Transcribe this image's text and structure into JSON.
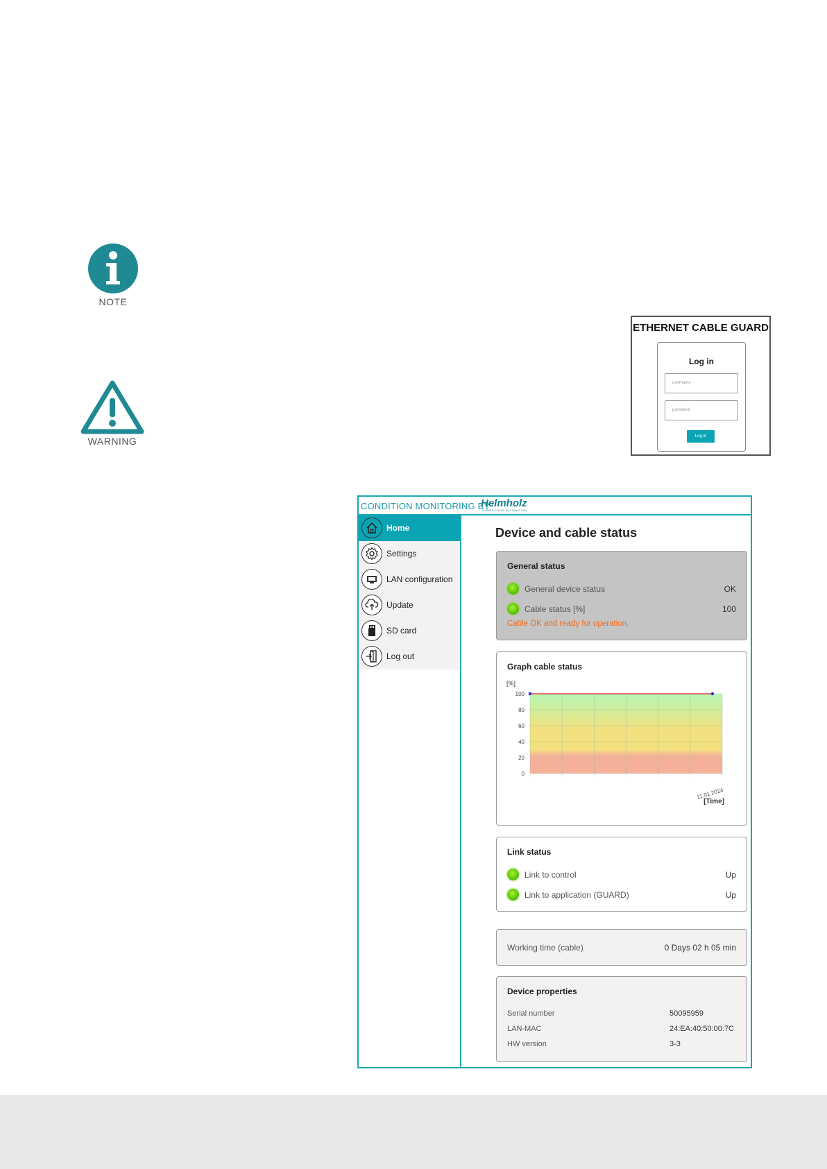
{
  "icons": {
    "note": {
      "label": "NOTE",
      "color": "#1f8a94"
    },
    "warning": {
      "label": "WARNING",
      "color": "#1f8a94"
    }
  },
  "login": {
    "product_title": "ETHERNET CABLE GUARD",
    "heading": "Log in",
    "username_placeholder": "username",
    "password_placeholder": "password",
    "button_label": "Log in"
  },
  "app": {
    "brand_text": "CONDITION MONITORING BY",
    "brand_logo": "Helmholz",
    "brand_tagline": "CONNECTING AUTOMATION",
    "accent_color": "#0aa4b4",
    "nav": [
      {
        "label": "Home",
        "icon": "home-icon",
        "active": true
      },
      {
        "label": "Settings",
        "icon": "gear-icon",
        "active": false
      },
      {
        "label": "LAN configuration",
        "icon": "lan-icon",
        "active": false
      },
      {
        "label": "Update",
        "icon": "cloud-upload-icon",
        "active": false
      },
      {
        "label": "SD card",
        "icon": "sd-card-icon",
        "active": false
      },
      {
        "label": "Log out",
        "icon": "logout-icon",
        "active": false
      }
    ],
    "page_title": "Device and cable status",
    "general_status": {
      "title": "General status",
      "rows": [
        {
          "label": "General device status",
          "value": "OK"
        },
        {
          "label": "Cable status [%]",
          "value": "100"
        }
      ],
      "message": "Cable OK and ready for operation."
    },
    "graph": {
      "title": "Graph cable status"
    },
    "link_status": {
      "title": "Link status",
      "rows": [
        {
          "label": "Link to control",
          "value": "Up"
        },
        {
          "label": "Link to application (GUARD)",
          "value": "Up"
        }
      ]
    },
    "working_time": {
      "label": "Working time (cable)",
      "value": "0 Days 02 h 05 min"
    },
    "device_properties": {
      "title": "Device properties",
      "rows": [
        {
          "label": "Serial number",
          "value": "50095959"
        },
        {
          "label": "LAN-MAC",
          "value": "24:EA:40:50:00:7C"
        },
        {
          "label": "HW version",
          "value": "3-3"
        }
      ]
    }
  },
  "chart_data": {
    "type": "line",
    "title": "Graph cable status",
    "ylabel": "[%]",
    "xlabel": "[Time]",
    "ylim": [
      0,
      100
    ],
    "yticks": [
      0,
      20,
      40,
      60,
      80,
      100
    ],
    "x_tick_labels": [
      "11.01.2024"
    ],
    "series": [
      {
        "values": [
          100,
          100
        ],
        "color": "#e8434b"
      }
    ],
    "background_gradient": [
      "#f6b09a",
      "#f3e07e",
      "#b6f7b4"
    ],
    "grid": true
  }
}
